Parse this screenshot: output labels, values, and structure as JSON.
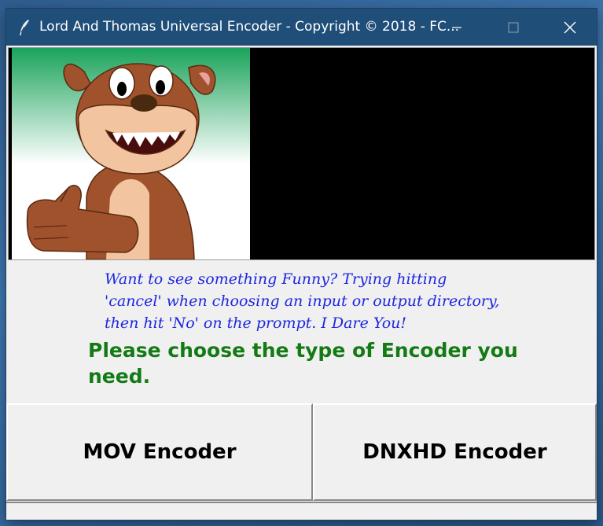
{
  "window": {
    "title": "Lord And Thomas Universal Encoder - Copyright © 2018 - FC...",
    "icon": "feather-icon"
  },
  "controls": {
    "minimize_icon": "minimize-icon",
    "maximize_icon": "maximize-icon",
    "close_icon": "close-icon"
  },
  "content": {
    "funny_message": "Want to see something Funny? Trying hitting\n'cancel' when choosing an input or output directory,\nthen hit 'No' on the prompt. I Dare You!",
    "prompt": "Please choose the type of Encoder you need."
  },
  "buttons": {
    "mov_label": "MOV Encoder",
    "dnxhd_label": "DNXHD Encoder"
  },
  "colors": {
    "titlebar": "#1f4e79",
    "funny_text": "#1d27e0",
    "prompt_text": "#147a14"
  }
}
